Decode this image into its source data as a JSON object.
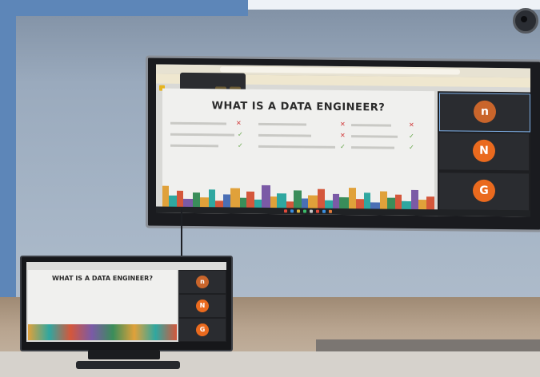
{
  "slide": {
    "title": "WHAT IS A DATA ENGINEER?",
    "monitor_title": "WHAT IS A DATA ENGINEER?"
  },
  "participants": [
    {
      "initial": "n",
      "color": "#c9652b"
    },
    {
      "initial": "N",
      "color": "#ea6a1e"
    },
    {
      "initial": "G",
      "color": "#ea6a1e"
    }
  ],
  "marks": {
    "cross_color": "#d13b3b",
    "check_color": "#6aa84f"
  }
}
